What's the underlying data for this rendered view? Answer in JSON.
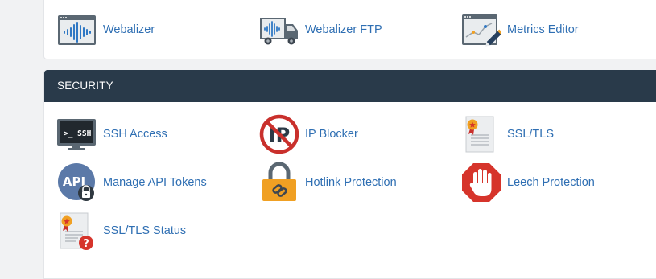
{
  "metrics": {
    "items": [
      {
        "label": "Webalizer"
      },
      {
        "label": "Webalizer FTP"
      },
      {
        "label": "Metrics Editor"
      }
    ]
  },
  "security": {
    "header": "SECURITY",
    "items": [
      {
        "label": "SSH Access",
        "icon_text": ">_ SSH"
      },
      {
        "label": "IP Blocker",
        "icon_text": "IP"
      },
      {
        "label": "SSL/TLS"
      },
      {
        "label": "Manage API Tokens",
        "icon_text": "API"
      },
      {
        "label": "Hotlink Protection"
      },
      {
        "label": "Leech Protection"
      },
      {
        "label": "SSL/TLS Status",
        "icon_text": "?"
      }
    ]
  },
  "colors": {
    "header_bg": "#293a4a",
    "link": "#2f6fb3",
    "page_bg": "#f1f2f3",
    "icon_red": "#d6342b",
    "icon_orange": "#f0a023",
    "icon_blue": "#5b79a8"
  },
  "icons": [
    "webalizer-icon",
    "webalizer-ftp-icon",
    "metrics-editor-icon",
    "ssh-icon",
    "ip-blocker-icon",
    "ssl-certificate-icon",
    "api-icon",
    "padlock-icon",
    "stop-hand-icon",
    "ssl-status-icon"
  ]
}
